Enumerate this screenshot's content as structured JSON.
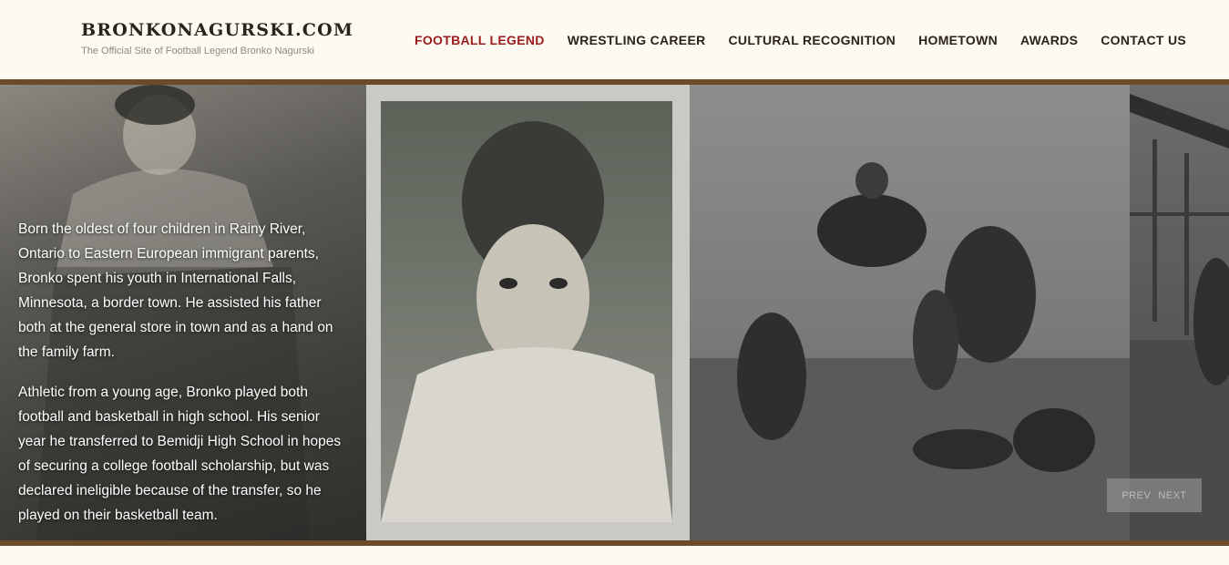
{
  "site": {
    "title": "BRONKONAGURSKI.COM",
    "tagline": "The Official Site of Football Legend Bronko Nagurski"
  },
  "nav": {
    "items": [
      {
        "label": "FOOTBALL LEGEND",
        "active": true
      },
      {
        "label": "WRESTLING CAREER"
      },
      {
        "label": "CULTURAL RECOGNITION"
      },
      {
        "label": "HOMETOWN"
      },
      {
        "label": "AWARDS"
      },
      {
        "label": "CONTACT US"
      }
    ]
  },
  "slide": {
    "paragraphs": [
      "Born the oldest of four children in Rainy River, Ontario to Eastern European immigrant parents, Bronko spent his youth in International Falls, Minnesota, a border town. He assisted his father both at the general store in town and as a hand on the family farm.",
      "Athletic from a young age, Bronko played both football and basketball in high school. His senior year he transferred to Bemidji High School in hopes of securing a college football scholarship, but was declared ineligible because of the transfer, so he played on their basketball team."
    ]
  },
  "controls": {
    "prev": "PREV",
    "next": "NEXT"
  },
  "colors": {
    "accent": "#9b1c1c",
    "band": "#6b4c2a",
    "background": "#fdfaf2"
  }
}
